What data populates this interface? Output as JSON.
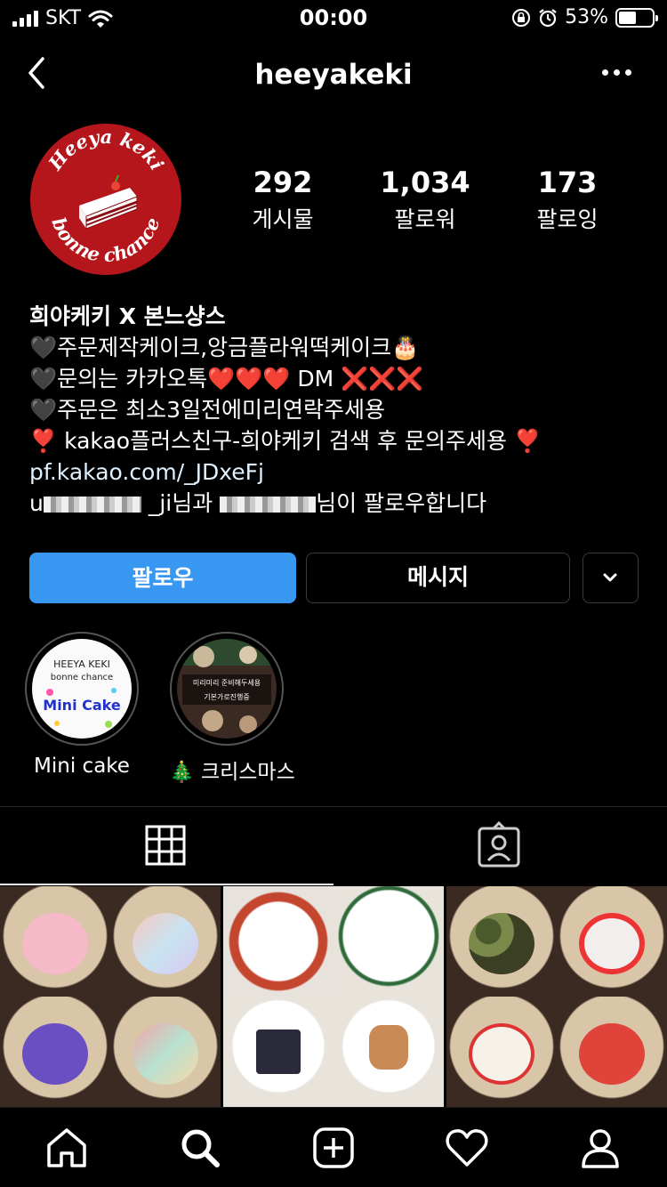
{
  "status_bar": {
    "carrier": "SKT",
    "time": "00:00",
    "battery_percent": "53%",
    "battery_level": 0.53
  },
  "header": {
    "username": "heeyakeki"
  },
  "profile": {
    "avatar_text_top": "Heeya keki",
    "avatar_text_bottom": "bonne chance",
    "stats": [
      {
        "value": "292",
        "label": "게시물"
      },
      {
        "value": "1,034",
        "label": "팔로워"
      },
      {
        "value": "173",
        "label": "팔로잉"
      }
    ],
    "bio": {
      "name": "희야케키 X 본느샹스",
      "line1": "🖤주문제작케이크,앙금플라워떡케이크🎂",
      "line2": "🖤문의는 카카오톡❤️❤️❤️ DM ❌❌❌",
      "line3": "🖤주문은 최소3일전에미리연락주세용",
      "line4": "❣️ kakao플러스친구-희야케키 검색 후 문의주세용 ❣️",
      "link": "pf.kakao.com/_JDxeFj",
      "followed_by_prefix": "u",
      "followed_by_mid": "_ji님과",
      "followed_by_suffix": "님이 팔로우합니다"
    }
  },
  "actions": {
    "follow_label": "팔로우",
    "message_label": "메시지"
  },
  "highlights": [
    {
      "label": "Mini cake",
      "cover_line1": "HEEYA KEKI",
      "cover_line2": "bonne chance",
      "cover_line3": "Mini Cake"
    },
    {
      "label": "🎄 크리스마스",
      "cover_line1": "미리미리 준비해두세용",
      "cover_line2": "기본가로진행중"
    }
  ],
  "colors": {
    "accent": "#3897f0",
    "background": "#000000",
    "avatar_red": "#b5161c"
  }
}
